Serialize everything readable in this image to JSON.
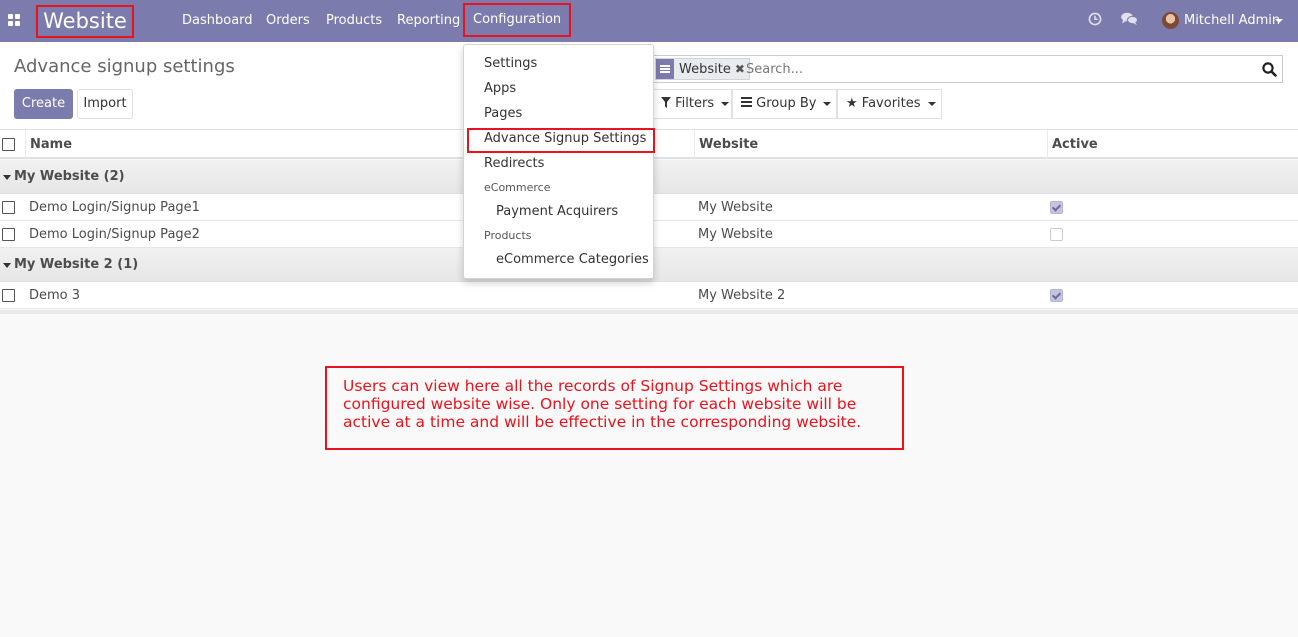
{
  "navbar": {
    "app_title": "Website",
    "menus": [
      "Dashboard",
      "Orders",
      "Products",
      "Reporting",
      "Configuration"
    ],
    "user_name": "Mitchell Admin"
  },
  "control_panel": {
    "breadcrumb": "Advance signup settings",
    "create_label": "Create",
    "import_label": "Import",
    "search": {
      "facet": "Website",
      "placeholder": "Search..."
    },
    "filters_label": "Filters",
    "group_by_label": "Group By",
    "favorites_label": "Favorites"
  },
  "table": {
    "columns": [
      "Name",
      "Website",
      "Active"
    ],
    "groups": [
      {
        "label": "My Website (2)",
        "rows": [
          {
            "name": "Demo Login/Signup Page1",
            "website": "My Website",
            "active": true
          },
          {
            "name": "Demo Login/Signup Page2",
            "website": "My Website",
            "active": false
          }
        ]
      },
      {
        "label": "My Website 2 (1)",
        "rows": [
          {
            "name": "Demo 3",
            "website": "My Website 2",
            "active": true
          }
        ]
      }
    ]
  },
  "dropdown": {
    "items": [
      "Settings",
      "Apps",
      "Pages",
      "Advance Signup Settings",
      "Redirects"
    ],
    "ecommerce_header": "eCommerce",
    "ecommerce_items": [
      "Payment Acquirers"
    ],
    "products_header": "Products",
    "products_items": [
      "eCommerce Categories"
    ]
  },
  "annotation": "Users can view here all the records of Signup Settings which are configured website wise. Only one setting for each website will be active at a time and will be effective in the corresponding website.",
  "colors": {
    "brand": "#7c7bad",
    "highlight": "#e8131d"
  }
}
